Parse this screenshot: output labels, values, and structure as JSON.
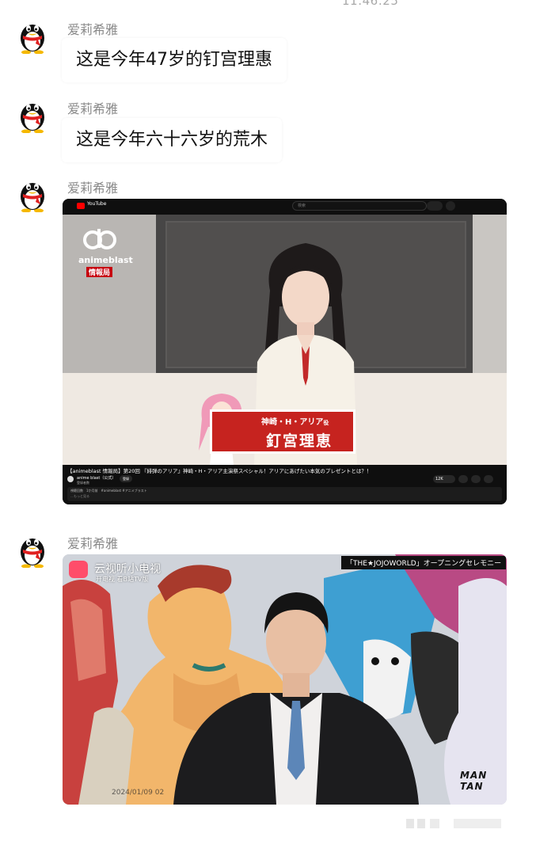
{
  "status": {
    "time": "11:46:25"
  },
  "messages": [
    {
      "sender": "爱莉希雅",
      "text": "这是今年47岁的钉宫理惠"
    },
    {
      "sender": "爱莉希雅",
      "text": "这是今年六十六岁的荒木"
    },
    {
      "sender": "爱莉希雅"
    },
    {
      "sender": "爱莉希雅"
    }
  ],
  "youtube_shot": {
    "logo": "YouTube",
    "search_placeholder": "検索",
    "channel_logo_line1": "animeblast",
    "channel_logo_badge": "情報局",
    "plate_sub": "神崎・H・アリア",
    "plate_sub_suffix": "役",
    "plate_name": "釘宮理恵",
    "video_title": "【animeblast 情報局】第20回 『緋弾のアリア』神崎・H・アリア主演祭スペシャル！アリアにあげたい本気のプレゼントとは？！",
    "channel_name": "anime blast（公式）",
    "subscriber_text": "登録者数",
    "subscribe_label": "登録",
    "likes": "12K",
    "desc_line1": "視聴回数　1か月前　#animeblast #アニメブラスト",
    "desc_line2": "…もっと見る"
  },
  "tv_shot": {
    "station_title": "云视听小电视",
    "station_sub": "开电视 看B站TV版",
    "caption": "「THE★JOJOWORLD」オープニングセレモニー",
    "date": "2024/01/09 02",
    "watermark_line1": "MAN",
    "watermark_line2": "TAN"
  },
  "colors": {
    "background": "#ffffff",
    "sender_name": "#8a8a8a",
    "bubble_text": "#111111",
    "youtube_red": "#ff0000",
    "name_plate": "#c6231f"
  },
  "icons": [
    "qq-penguin-avatar-icon",
    "youtube-logo-icon",
    "search-icon",
    "mic-icon",
    "like-icon",
    "share-icon",
    "download-icon",
    "save-icon",
    "tv-station-logo-icon"
  ]
}
